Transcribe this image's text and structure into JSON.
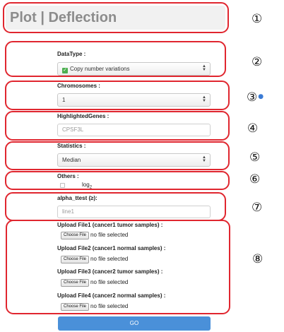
{
  "title": "Plot | Deflection",
  "form": {
    "datatype": {
      "label": "DataType :",
      "value": "Copy number variations"
    },
    "chromosomes": {
      "label": "Chromosomes :",
      "value": "1"
    },
    "genes": {
      "label": "HighlightedGenes :",
      "placeholder": "CPSF3L"
    },
    "statistics": {
      "label": "Statistics :",
      "value": "Median"
    },
    "others": {
      "label": "Others :",
      "log_label": "log",
      "log_sub": "2"
    },
    "alpha": {
      "label": "alpha_ttest (≥):",
      "placeholder": "line1"
    },
    "uploads": [
      {
        "label": "Upload File1 (cancer1 tumor samples) :",
        "button": "Choose File",
        "status": "no file selected"
      },
      {
        "label": "Upload File2 (cancer1 normal samples) :",
        "button": "Choose File",
        "status": "no file selected"
      },
      {
        "label": "Upload File3 (cancer2 tumor samples) :",
        "button": "Choose File",
        "status": "no file selected"
      },
      {
        "label": "Upload File4 (cancer2 normal samples) :",
        "button": "Choose File",
        "status": "no file selected"
      }
    ],
    "go_label": "GO"
  },
  "markers": [
    "①",
    "②",
    "③",
    "④",
    "⑤",
    "⑥",
    "⑦",
    "⑧"
  ],
  "colors": {
    "annotation_border": "#e0262f",
    "go_button": "#4a90d9",
    "title_text": "#8c8c8c",
    "check": "#4caf50"
  }
}
